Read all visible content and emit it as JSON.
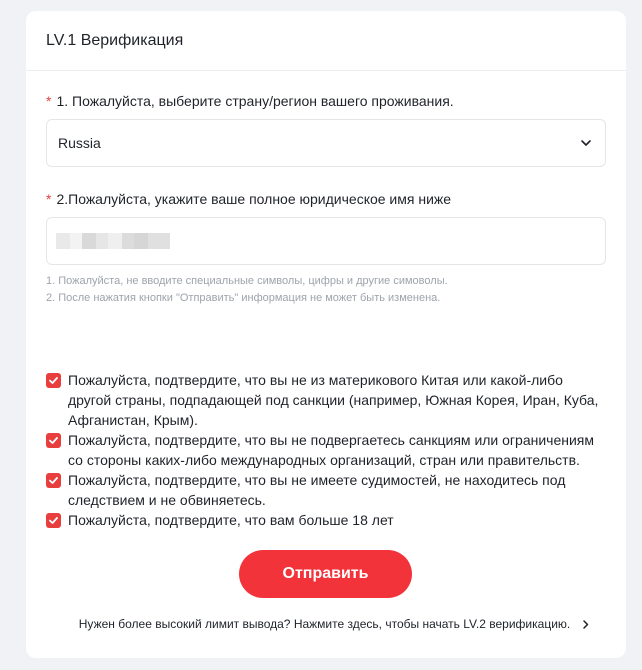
{
  "header": {
    "title": "LV.1 Верификация"
  },
  "required_mark": "*",
  "country": {
    "label": "1. Пожалуйста, выберите страну/регион вашего проживания.",
    "selected": "Russia",
    "icon": "chevron-down-icon"
  },
  "name": {
    "label": "2.Пожалуйста, укажите ваше полное юридическое имя ниже",
    "value": ""
  },
  "hints": [
    "1. Пожалуйста, не вводите специальные символы, цифры и другие симоволы.",
    "2. После нажатия кнопки \"Отправить\" информация не может быть изменена."
  ],
  "confirmations": [
    {
      "text": "Пожалуйста, подтвердите, что вы не из материкового Китая или какой-либо другой страны, подпадающей под санкции (например, Южная Корея, Иран, Куба, Афганистан, Крым).",
      "checked": true
    },
    {
      "text": "Пожалуйста, подтвердите, что вы не подвергаетесь санкциям или ограничениям со стороны каких-либо международных организаций, стран или правительств.",
      "checked": true
    },
    {
      "text": "Пожалуйста, подтвердите, что вы не имеете судимостей, не находитесь под следствием и не обвиняетесь.",
      "checked": true
    },
    {
      "text": "Пожалуйста, подтвердите, что вам больше 18 лет",
      "checked": true
    }
  ],
  "submit_label": "Отправить",
  "lv2_link": "Нужен более высокий лимит вывода? Нажмите здесь, чтобы начать LV.2 верификацию.",
  "colors": {
    "accent": "#f2333a",
    "checkbox": "#e83e3e",
    "hint": "#9ea3ab",
    "page_bg": "#f1f2f5"
  }
}
